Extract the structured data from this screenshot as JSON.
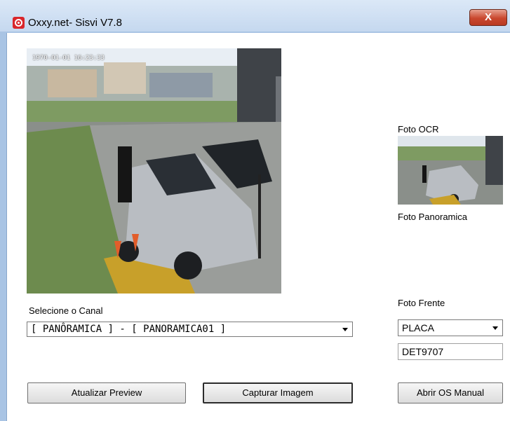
{
  "window": {
    "title": "Oxxy.net- Sisvi V7.8",
    "close_label": "X"
  },
  "preview": {
    "timestamp": "1970-01-01 16:23:33"
  },
  "canal": {
    "label": "Selecione o Canal",
    "selected": "[ PANÔRAMICA ] - [ PANORAMICA01 ]"
  },
  "right": {
    "foto_ocr_label": "Foto OCR",
    "foto_panoramica_label": "Foto Panoramica",
    "foto_frente_label": "Foto Frente",
    "placa_selected": "PLACA",
    "placa_value": "DET9707"
  },
  "buttons": {
    "atualizar": "Atualizar Preview",
    "capturar": "Capturar Imagem",
    "abrir_os": "Abrir OS Manual"
  }
}
